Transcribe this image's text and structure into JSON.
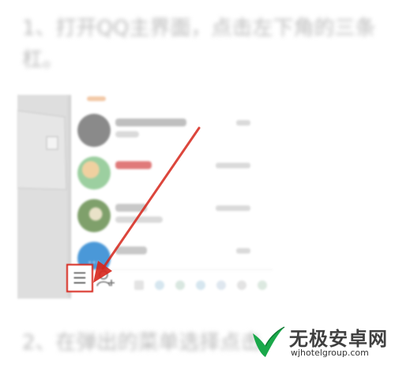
{
  "article": {
    "step1_line1": "1、打开QQ主界面，点击左下角的三条",
    "step1_line2": "杠。",
    "step2_line1": "2、在弹出的菜单选择点击"
  },
  "qq_window": {
    "chats": [
      {
        "name_color": "#bfbfbf",
        "avatar_color": "#8a8a8a"
      },
      {
        "name_color": "#e07a7a",
        "avatar_color": "#9ccfa0"
      },
      {
        "name_color": "#c8c8c8",
        "avatar_color": "#7fa06b"
      },
      {
        "name_color": "#c8c8c8",
        "avatar_color": "#4a98d8",
        "avatar_glyph": "…"
      }
    ],
    "menu_button_glyph": "☰",
    "menu_button_icon": "hamburger-menu-icon",
    "add_contact_icon": "add-contact-icon",
    "highlight_color": "#d7261b"
  },
  "watermark": {
    "name": "无极安卓网",
    "url": "wjhotelgroup.com",
    "logo_icon": "check-leaf-logo-icon",
    "logo_color": "#1aa84a"
  }
}
